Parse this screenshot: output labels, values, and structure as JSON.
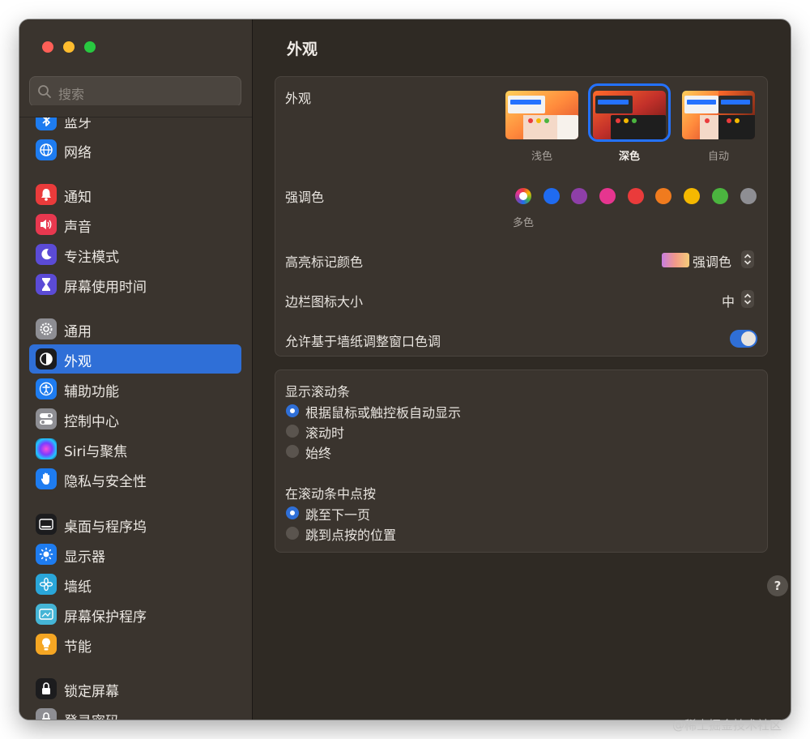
{
  "search": {
    "placeholder": "搜索"
  },
  "sidebar": {
    "items": [
      {
        "label": "蓝牙",
        "icon": "bluetooth-icon",
        "color": "#1e7cf0"
      },
      {
        "label": "网络",
        "icon": "globe-icon",
        "color": "#1e7cf0"
      },
      {
        "label": "通知",
        "icon": "bell-icon",
        "color": "#ea3b3b"
      },
      {
        "label": "声音",
        "icon": "speaker-icon",
        "color": "#e8384f"
      },
      {
        "label": "专注模式",
        "icon": "moon-icon",
        "color": "#5b4bd6"
      },
      {
        "label": "屏幕使用时间",
        "icon": "hourglass-icon",
        "color": "#5b4bd6"
      },
      {
        "label": "通用",
        "icon": "gear-icon",
        "color": "#8e8e93"
      },
      {
        "label": "外观",
        "icon": "appearance-icon",
        "color": "#1c1c1e"
      },
      {
        "label": "辅助功能",
        "icon": "accessibility-icon",
        "color": "#1e7cf0"
      },
      {
        "label": "控制中心",
        "icon": "toggles-icon",
        "color": "#8e8e93"
      },
      {
        "label": "Siri与聚焦",
        "icon": "siri-icon",
        "color": "#2b1d4d"
      },
      {
        "label": "隐私与安全性",
        "icon": "hand-icon",
        "color": "#1e7cf0"
      },
      {
        "label": "桌面与程序坞",
        "icon": "dock-icon",
        "color": "#1c1c1e"
      },
      {
        "label": "显示器",
        "icon": "sun-icon",
        "color": "#1e7cf0"
      },
      {
        "label": "墙纸",
        "icon": "flower-icon",
        "color": "#2aa6d9"
      },
      {
        "label": "屏幕保护程序",
        "icon": "screensaver-icon",
        "color": "#45b5d6"
      },
      {
        "label": "节能",
        "icon": "bulb-icon",
        "color": "#f5a623"
      },
      {
        "label": "锁定屏幕",
        "icon": "lock-icon",
        "color": "#1c1c1e"
      },
      {
        "label": "登录密码",
        "icon": "password-icon",
        "color": "#8e8e93"
      }
    ],
    "selected": "外观"
  },
  "main": {
    "title": "外观",
    "appearance": {
      "label": "外观",
      "options": [
        "浅色",
        "深色",
        "自动"
      ],
      "selected": "深色"
    },
    "accent": {
      "label": "强调色",
      "colors": [
        "multicolor",
        "#1f6bf0",
        "#8e3fa8",
        "#e6358f",
        "#ea3b3b",
        "#f07b1e",
        "#f5b800",
        "#4bb53f",
        "#8e8e93"
      ],
      "selected_caption": "多色"
    },
    "highlight": {
      "label": "高亮标记颜色",
      "value": "强调色"
    },
    "sidebar_icon_size": {
      "label": "边栏图标大小",
      "value": "中"
    },
    "wallpaper_tinting": {
      "label": "允许基于墙纸调整窗口色调",
      "enabled": true
    },
    "scrollbars": {
      "label": "显示滚动条",
      "options": [
        "根据鼠标或触控板自动显示",
        "滚动时",
        "始终"
      ],
      "selected": "根据鼠标或触控板自动显示"
    },
    "click_scrollbar": {
      "label": "在滚动条中点按",
      "options": [
        "跳至下一页",
        "跳到点按的位置"
      ],
      "selected": "跳至下一页"
    },
    "help": "?"
  },
  "watermark": "@稀土掘金技术社区"
}
